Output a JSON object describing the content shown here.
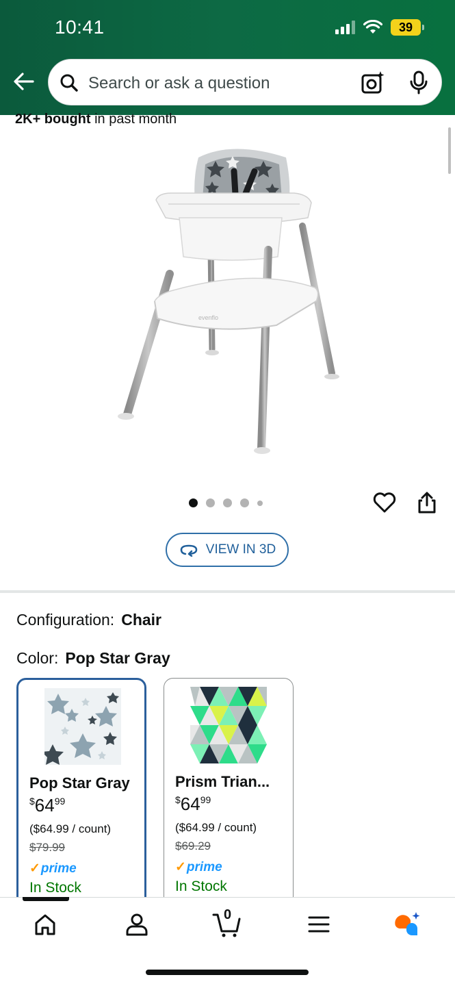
{
  "status_bar": {
    "time": "10:41",
    "battery": "39"
  },
  "search": {
    "placeholder": "Search or ask a question"
  },
  "social_proof": {
    "bold": "2K+ bought",
    "rest": "in past month"
  },
  "gallery": {
    "image_count": 5,
    "active_index": 0,
    "view3d_label": "VIEW IN 3D"
  },
  "options": {
    "configuration_label": "Configuration:",
    "configuration_value": "Chair",
    "color_label": "Color:",
    "color_value": "Pop Star Gray"
  },
  "swatches": [
    {
      "name": "Pop Star Gray",
      "price_currency": "$",
      "price_whole": "64",
      "price_cents": "99",
      "unit_price": "($64.99 / count)",
      "list_price": "$79.99",
      "prime": "prime",
      "stock": "In Stock",
      "selected": true
    },
    {
      "name": "Prism Trian...",
      "price_currency": "$",
      "price_whole": "64",
      "price_cents": "99",
      "unit_price": "($64.99 / count)",
      "list_price": "$69.29",
      "prime": "prime",
      "stock": "In Stock",
      "selected": false
    }
  ],
  "tab_bar": {
    "cart_count": "0"
  },
  "colors": {
    "header_green": "#0d6a44",
    "link_blue": "#1f5f9a",
    "prime_blue": "#1a98ff",
    "prime_check": "#ff9900",
    "stock_green": "#007600",
    "selected_border": "#2b5f9c"
  }
}
